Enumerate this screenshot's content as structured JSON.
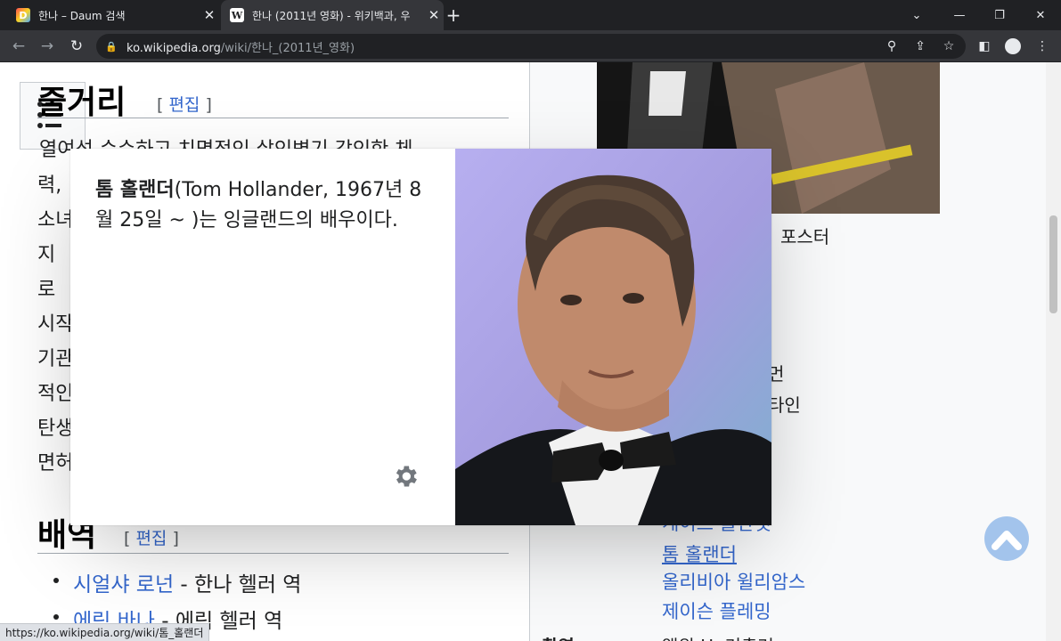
{
  "tabs": [
    {
      "title": "한나 – Daum 검색",
      "favicon": "D"
    },
    {
      "title": "한나 (2011년 영화) - 위키백과, 우",
      "favicon": "W"
    }
  ],
  "url": {
    "domain": "ko.wikipedia.org",
    "path": "/wiki/한나_(2011년_영화)"
  },
  "article": {
    "plot_heading": "줄거리",
    "edit_label": "편집",
    "plot_lines": [
      "열여섯 순수하고 치명적인 살인병기 강인한 체",
      "력,",
      "소녀",
      "지",
      "로",
      "시작",
      "기관",
      "적인",
      "탄생",
      "면허"
    ],
    "cast_heading": "배역",
    "cast": [
      {
        "actor": "시얼샤 로넌",
        "role": " - 한나 헬러 역"
      },
      {
        "actor": "에릭 바나",
        "role": " - 에릭 헬러 역"
      }
    ]
  },
  "sidebar": {
    "poster_caption": "포스터",
    "partial_lines": [
      "먼",
      "타인"
    ],
    "starring": [
      "케이트 블란쳇",
      "톰 홀랜더",
      "올리비아 윌리암스",
      "제이슨 플레밍"
    ],
    "next_label": "촬영",
    "next_value": "앨윈 H. 커츌러"
  },
  "popup": {
    "name": "톰 홀랜더",
    "text": "(Tom Hollander, 1967년 8월 25일 ~ )는 잉글랜드의 배우이다."
  },
  "status_bar": "https://ko.wikipedia.org/wiki/톰_홀랜더"
}
